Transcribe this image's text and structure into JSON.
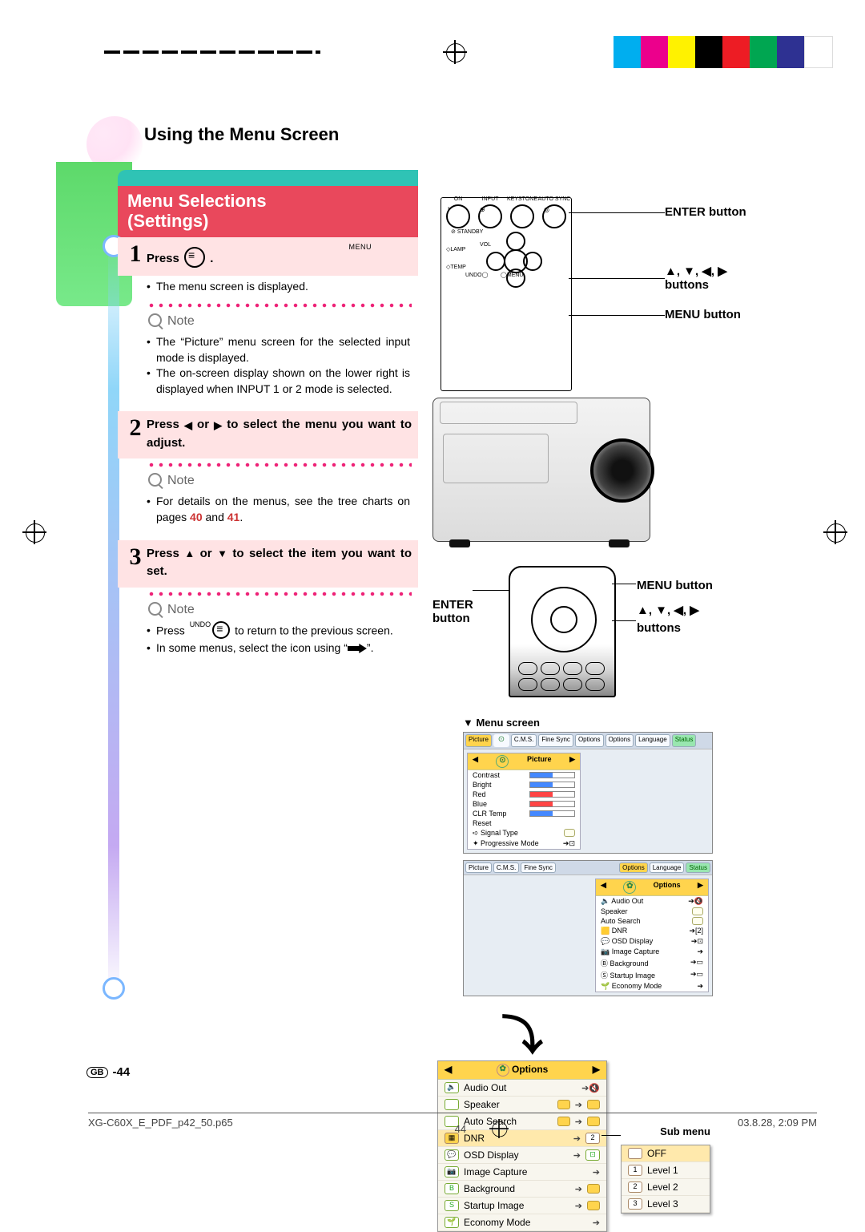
{
  "header": {
    "section_title": "Using the Menu Screen"
  },
  "title": {
    "line1": "Menu Selections",
    "line2": "(Settings)"
  },
  "steps": {
    "s1": {
      "num": "1",
      "label_pre": "Press",
      "menu_tiny": "MENU",
      "bullets": [
        "The menu screen is displayed."
      ]
    },
    "s1_note": {
      "label": "Note",
      "bullets": [
        "The “Picture” menu screen for the selected input mode is displayed.",
        "The on-screen display shown on the lower right is displayed when INPUT 1 or 2 mode is selected."
      ]
    },
    "s2": {
      "num": "2",
      "text_a": "Press ",
      "text_b": " or ",
      "text_c": " to select the menu you want to adjust."
    },
    "s2_note": {
      "label": "Note",
      "bullet_a": "For details on the menus, see the tree charts on pages ",
      "pg1": "40",
      "and": " and ",
      "pg2": "41",
      "dot": "."
    },
    "s3": {
      "num": "3",
      "text_a": "Press ",
      "text_b": " or ",
      "text_c": " to select the item you want to set."
    },
    "s3_note": {
      "label": "Note",
      "undo_tiny": "UNDO",
      "bullet1_a": "Press ",
      "bullet1_b": " to return to the previous screen.",
      "bullet2_a": "In some menus, select the icon using “",
      "bullet2_b": "”."
    }
  },
  "projector_panel": {
    "btn_on": "ON",
    "btn_input": "INPUT",
    "btn_keystone": "KEYSTONE",
    "btn_autosync": "AUTO SYNC",
    "standby": "STANDBY",
    "lamp": "LAMP",
    "temp": "TEMP",
    "vol": "VOL",
    "undo": "UNDO",
    "menu": "MENU"
  },
  "callouts": {
    "enter": "ENTER button",
    "arrows": "▲, ▼, ◀, ▶",
    "buttons": "buttons",
    "menu": "MENU button"
  },
  "remote_labels": {
    "enter": "ENTER",
    "button": "button",
    "menu": "MENU button",
    "arrows": "▲, ▼, ◀, ▶",
    "buttons_word": "buttons"
  },
  "menu_screen": {
    "header": "▼ Menu screen",
    "tabs1": {
      "picture": "Picture",
      "cms": "C.M.S.",
      "finesync": "Fine Sync",
      "options1": "Options",
      "options2": "Options",
      "language": "Language",
      "status": "Status"
    },
    "pic_rows": {
      "contrast": "Contrast",
      "bright": "Bright",
      "red": "Red",
      "blue": "Blue",
      "clrtemp": "CLR Temp",
      "reset": "Reset",
      "sigtype": "Signal Type",
      "progressive": "Progressive Mode"
    },
    "opts_rows": {
      "audioout": "Audio Out",
      "speaker": "Speaker",
      "autosearch": "Auto Search",
      "dnr": "DNR",
      "osd": "OSD Display",
      "imgcap": "Image Capture",
      "background": "Background",
      "startup": "Startup Image",
      "economy": "Economy Mode"
    }
  },
  "options_menu": {
    "title": "Options",
    "audioout": "Audio Out",
    "speaker": "Speaker",
    "autosearch": "Auto Search",
    "dnr": "DNR",
    "osd": "OSD Display",
    "imgcap": "Image Capture",
    "background": "Background",
    "startup": "Startup Image",
    "economy": "Economy Mode",
    "sub_label": "Sub menu",
    "sub": {
      "off": "OFF",
      "l1": "Level 1",
      "l2": "Level 2",
      "l3": "Level 3"
    },
    "val2": "2"
  },
  "page_footer": {
    "gb": "GB",
    "num": "-44"
  },
  "doc_footer": {
    "file": "XG-C60X_E_PDF_p42_50.p65",
    "pg": "44",
    "ts": "03.8.28, 2:09 PM"
  },
  "colorbar": [
    "#00aeef",
    "#ec008c",
    "#fff200",
    "#000000",
    "#ed1c24",
    "#00a651",
    "#2e3192",
    "#ffffff"
  ]
}
